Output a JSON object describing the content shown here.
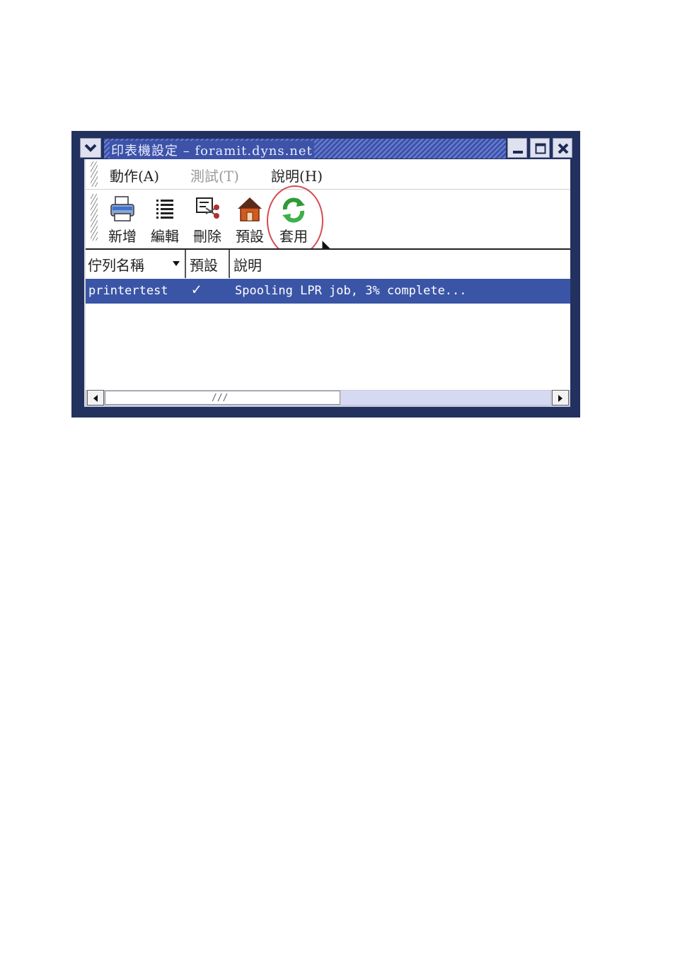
{
  "window": {
    "title": "印表機設定 – foramit.dyns.net"
  },
  "menu": {
    "items": [
      {
        "label": "動作(A)",
        "enabled": true
      },
      {
        "label": "測試(T)",
        "enabled": false
      },
      {
        "label": "說明(H)",
        "enabled": true
      }
    ]
  },
  "toolbar": {
    "buttons": [
      {
        "label": "新增",
        "icon": "printer-add-icon"
      },
      {
        "label": "編輯",
        "icon": "list-edit-icon"
      },
      {
        "label": "刪除",
        "icon": "delete-scissors-icon"
      },
      {
        "label": "預設",
        "icon": "home-default-icon"
      },
      {
        "label": "套用",
        "icon": "apply-refresh-icon"
      }
    ]
  },
  "table": {
    "columns": [
      "佇列名稱",
      "預設",
      "說明"
    ],
    "rows": [
      {
        "queue": "printertest",
        "default_mark": "✓",
        "description": "Spooling LPR job, 3% complete..."
      }
    ]
  },
  "colors": {
    "selection": "#3b55a6",
    "title_bar": "#3d52a8",
    "highlight_circle": "#d84a52"
  }
}
